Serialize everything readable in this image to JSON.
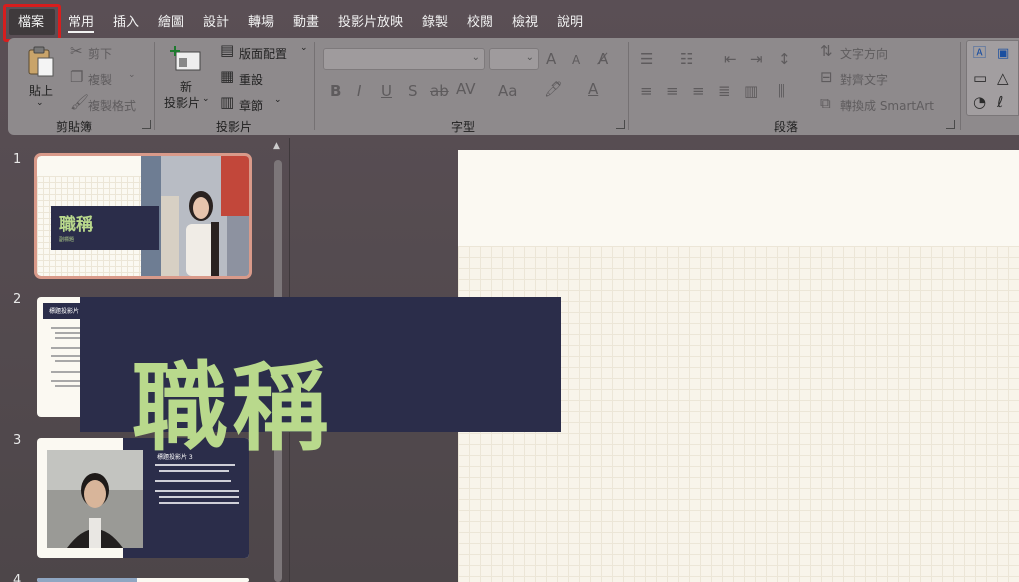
{
  "menu": {
    "tabs": [
      "檔案",
      "常用",
      "插入",
      "繪圖",
      "設計",
      "轉場",
      "動畫",
      "投影片放映",
      "錄製",
      "校閱",
      "檢視",
      "說明"
    ]
  },
  "ribbon": {
    "clipboard": {
      "paste": "貼上",
      "cut": "剪下",
      "copy": "複製",
      "format_painter": "複製格式",
      "group": "剪貼簿"
    },
    "slides": {
      "new_slide_line1": "新",
      "new_slide_line2": "投影片",
      "layout": "版面配置",
      "reset": "重設",
      "section": "章節",
      "group": "投影片"
    },
    "font": {
      "group": "字型",
      "bold": "B",
      "italic": "I",
      "underline": "U",
      "shadow": "S",
      "strike": "ab",
      "spacing": "AV",
      "case": "Aa",
      "grow": "A",
      "shrink": "A",
      "color": "A"
    },
    "paragraph": {
      "group": "段落",
      "text_direction": "文字方向",
      "align_text": "對齊文字",
      "smartart": "轉換成 SmartArt"
    }
  },
  "slides_panel": {
    "numbers": [
      "1",
      "2",
      "3",
      "4"
    ],
    "slide1": {
      "title": "職稱",
      "subtitle": "副標題"
    },
    "slide2": {
      "title": "標題投影片 2"
    },
    "slide3": {
      "title": "標題投影片 3"
    }
  },
  "main_slide": {
    "title": "職稱"
  },
  "colors": {
    "highlight": "#d81d1d",
    "slide_navy": "#2b2d4a",
    "title_green": "#b9d98c",
    "selected_outline": "#d99a8a"
  }
}
